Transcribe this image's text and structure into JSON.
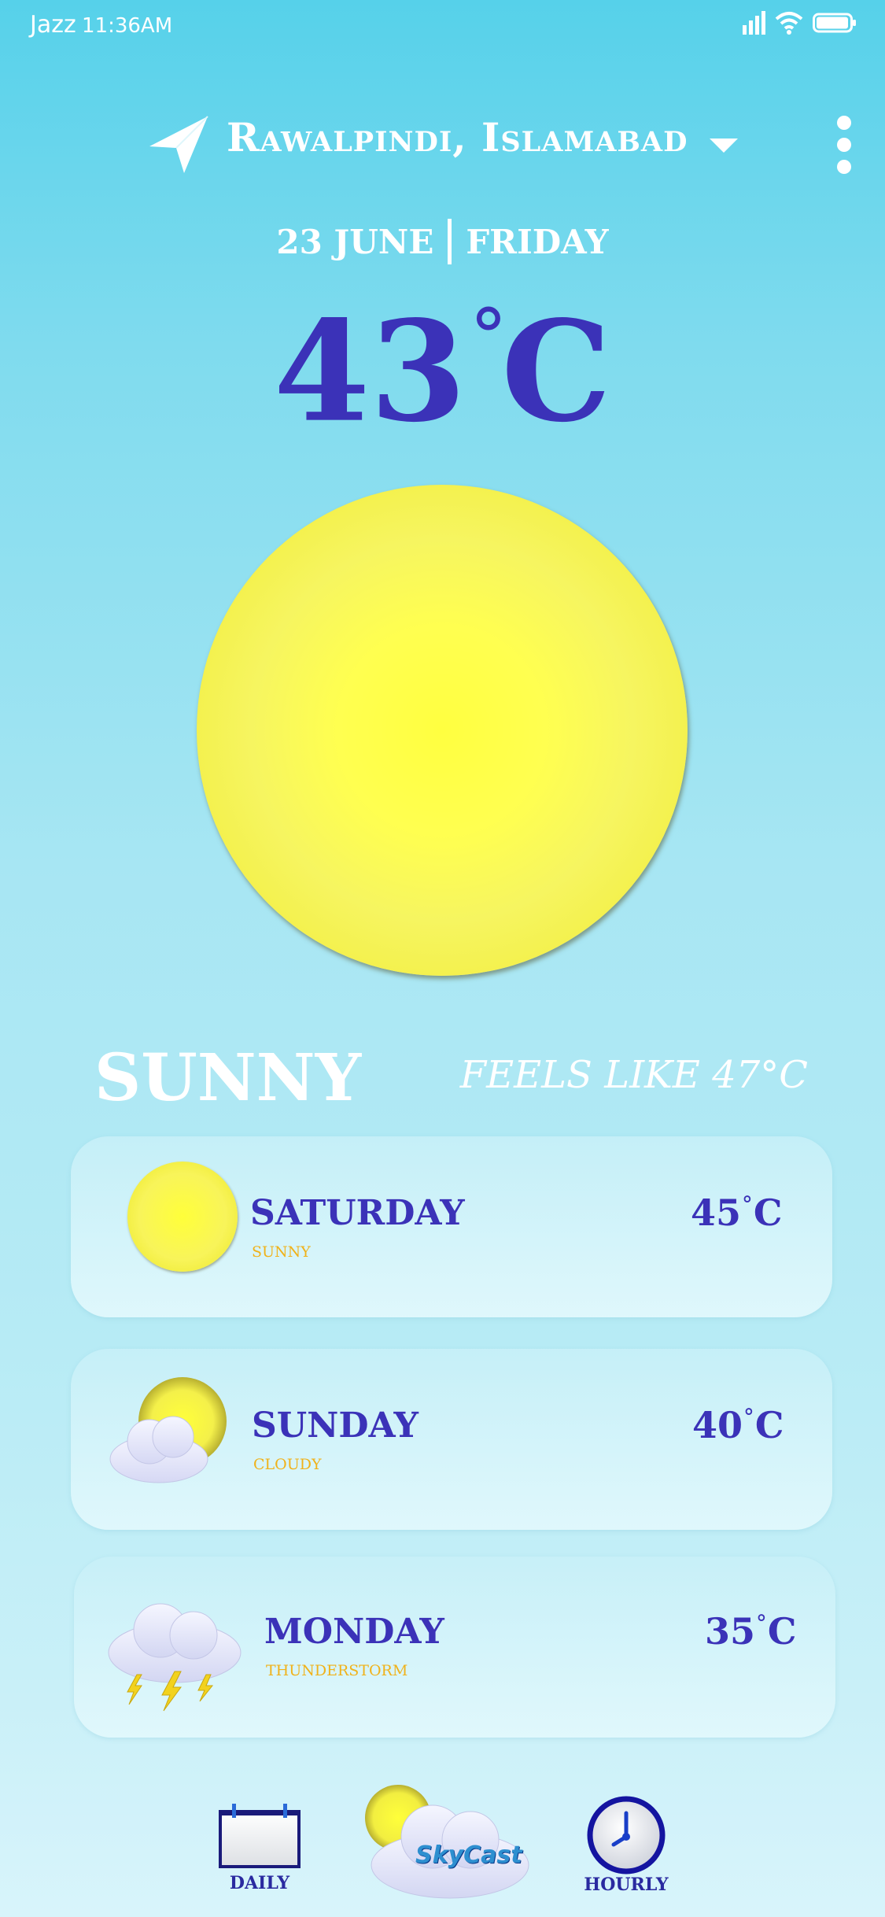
{
  "status": {
    "carrier": "Jazz",
    "time": "11:36AM"
  },
  "header": {
    "location": "Rawalpindi, Islamabad",
    "date": "23 JUNE",
    "weekday": "FRIDAY"
  },
  "current": {
    "temp": "43",
    "unit": "C",
    "condition": "SUNNY",
    "feels_like": "FEELS LIKE 47",
    "feels_unit": "C"
  },
  "forecast": [
    {
      "day": "SATURDAY",
      "condition": "SUNNY",
      "temp": "45",
      "unit": "C",
      "icon": "sun-icon"
    },
    {
      "day": "SUNDAY",
      "condition": "CLOUDY",
      "temp": "40",
      "unit": "C",
      "icon": "partly-cloudy-icon"
    },
    {
      "day": "MONDAY",
      "condition": "THUNDERSTORM",
      "temp": "35",
      "unit": "C",
      "icon": "thunderstorm-icon"
    }
  ],
  "nav": {
    "daily": "DAILY",
    "logo": "SkyCast",
    "hourly": "HOURLY"
  },
  "colors": {
    "accent": "#3b32b8",
    "condition_text": "#f0b21a",
    "sun": "#ffff40"
  }
}
